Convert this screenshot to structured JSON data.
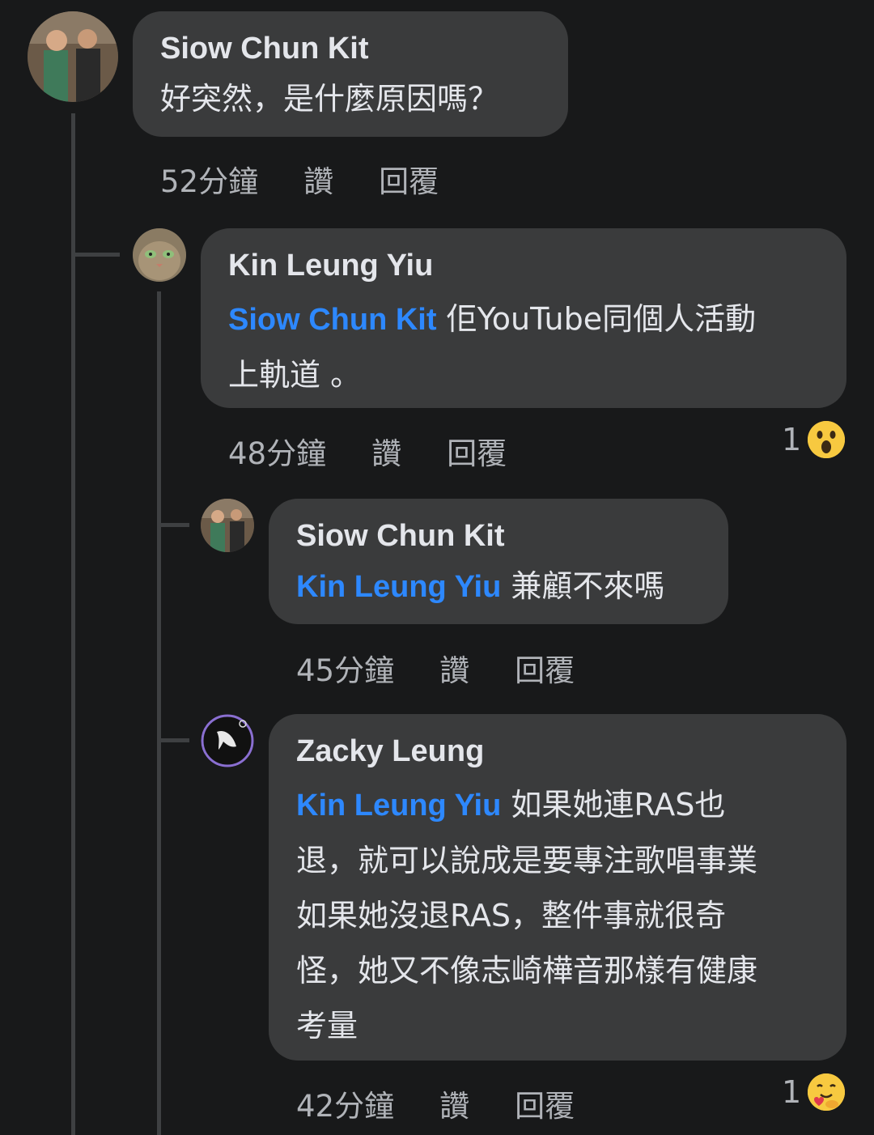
{
  "comments": [
    {
      "author": "Siow Chun Kit",
      "mention": "",
      "text": "好突然，是什麼原因嗎？",
      "time": "52分鐘",
      "like": "讚",
      "reply": "回覆"
    },
    {
      "author": "Kin Leung Yiu",
      "mention": "Siow Chun Kit",
      "text_line1": " 佢YouTube同個人活動",
      "text_line2": "上軌道 。",
      "time": "48分鐘",
      "like": "讚",
      "reply": "回覆",
      "reaction_count": "1",
      "reaction_icon": "wow-emoji-icon"
    },
    {
      "author": "Siow Chun Kit",
      "mention": "Kin Leung Yiu",
      "text": " 兼顧不來嗎",
      "time": "45分鐘",
      "like": "讚",
      "reply": "回覆"
    },
    {
      "author": "Zacky Leung",
      "mention": "Kin Leung Yiu",
      "text_line1": " 如果她連RAS也",
      "text_line2": "退，就可以說成是要專注歌唱事業",
      "text_line3": "如果她沒退RAS，整件事就很奇",
      "text_line4": "怪，她又不像志崎樺音那樣有健康",
      "text_line5": "考量",
      "time": "42分鐘",
      "like": "讚",
      "reply": "回覆",
      "reaction_count": "1",
      "reaction_icon": "care-emoji-icon"
    }
  ],
  "colors": {
    "background": "#18191a",
    "bubble": "#3a3b3c",
    "mention": "#2d88ff",
    "meta": "#b0b3b8"
  }
}
